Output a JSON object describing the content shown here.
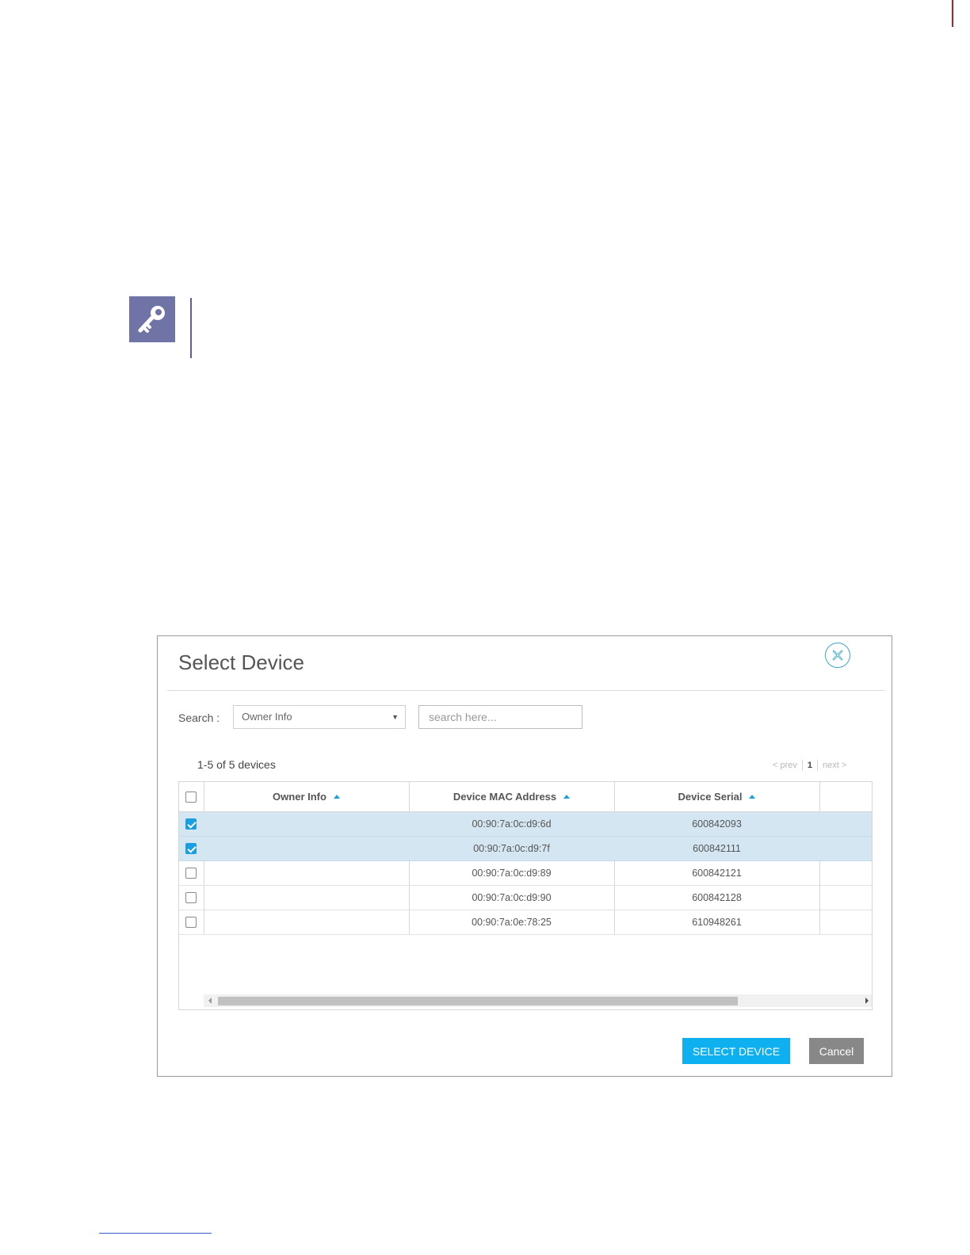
{
  "dialog": {
    "title": "Select Device",
    "search": {
      "label": "Search :",
      "field_selected": "Owner Info",
      "placeholder": "search here..."
    },
    "count_text": "1-5 of 5 devices",
    "pager": {
      "prev": "< prev",
      "current": "1",
      "next": "next >"
    },
    "columns": [
      "Owner Info",
      "Device MAC Address",
      "Device Serial"
    ],
    "rows": [
      {
        "selected": true,
        "owner": "",
        "mac": "00:90:7a:0c:d9:6d",
        "serial": "600842093"
      },
      {
        "selected": true,
        "owner": "",
        "mac": "00:90:7a:0c:d9:7f",
        "serial": "600842111"
      },
      {
        "selected": false,
        "owner": "",
        "mac": "00:90:7a:0c:d9:89",
        "serial": "600842121"
      },
      {
        "selected": false,
        "owner": "",
        "mac": "00:90:7a:0c:d9:90",
        "serial": "600842128"
      },
      {
        "selected": false,
        "owner": "",
        "mac": "00:90:7a:0e:78:25",
        "serial": "610948261"
      }
    ],
    "buttons": {
      "select": "SELECT DEVICE",
      "cancel": "Cancel"
    }
  },
  "icons": {
    "note": "key-icon",
    "close": "close-circle-icon"
  },
  "colors": {
    "accent": "#0fb0ef",
    "note_box": "#6f73a5",
    "row_selected": "#d4e6f1"
  }
}
